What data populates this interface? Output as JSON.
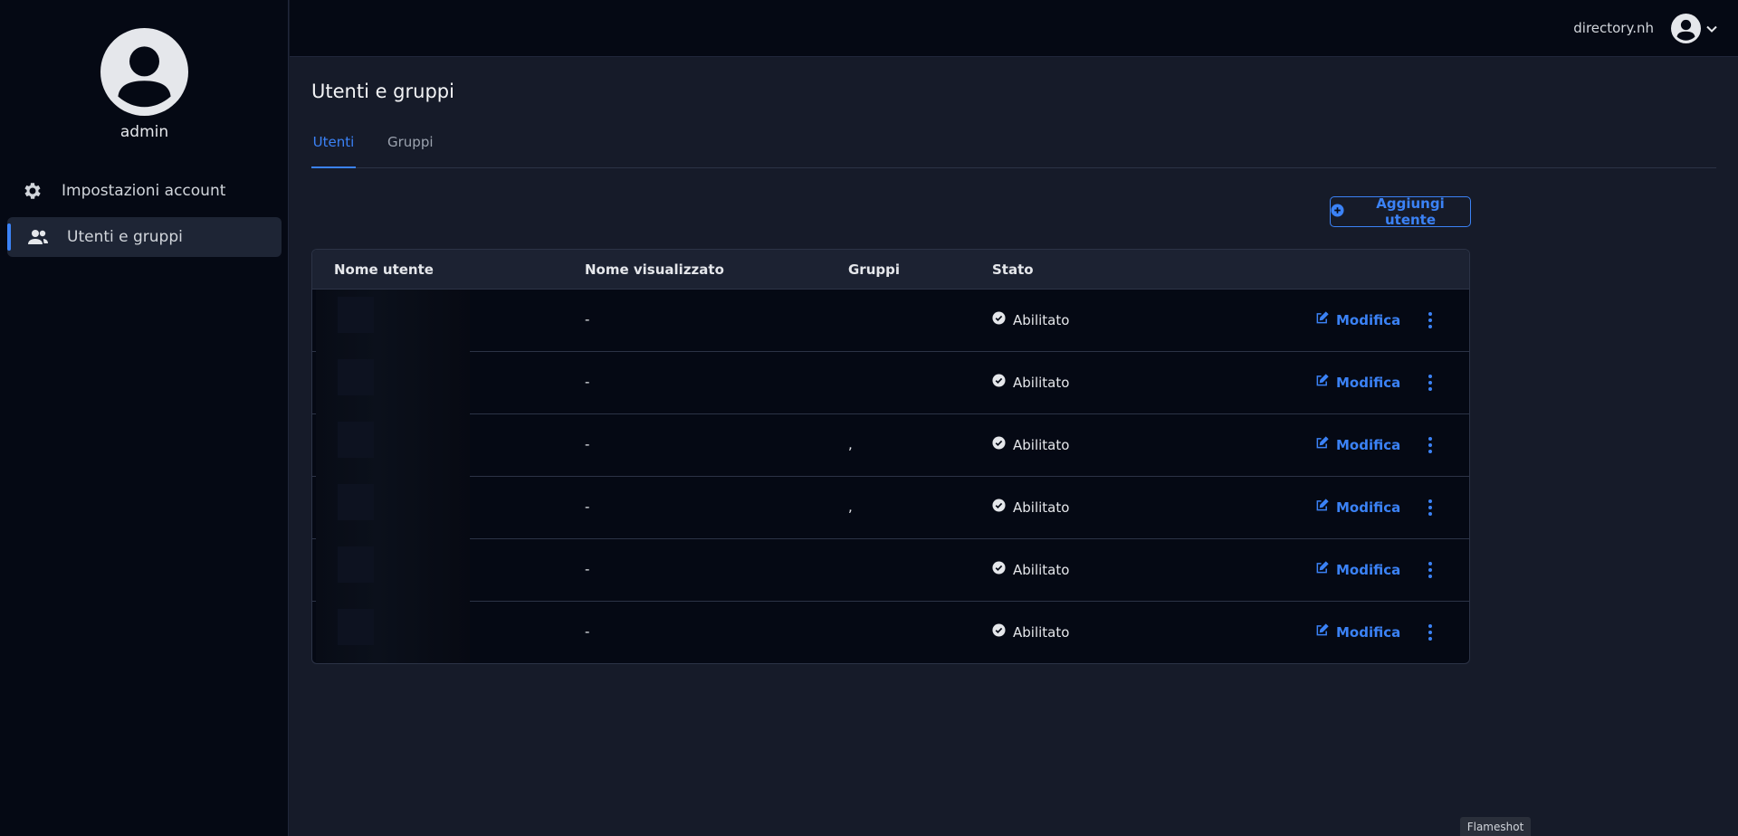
{
  "sidebar": {
    "username": "admin",
    "items": [
      {
        "label": "Impostazioni account",
        "icon": "gear-icon",
        "active": false
      },
      {
        "label": "Utenti e gruppi",
        "icon": "users-icon",
        "active": true
      }
    ]
  },
  "topbar": {
    "domain": "directory.nh"
  },
  "main": {
    "title": "Utenti e gruppi",
    "tabs": [
      {
        "label": "Utenti",
        "active": true
      },
      {
        "label": "Gruppi",
        "active": false
      }
    ],
    "add_button_label": "Aggiungi utente"
  },
  "table": {
    "columns": [
      "Nome utente",
      "Nome visualizzato",
      "Gruppi",
      "Stato"
    ],
    "rows": [
      {
        "display_name": "-",
        "groups": "",
        "status": "Abilitato",
        "edit_label": "Modifica"
      },
      {
        "display_name": "-",
        "groups": "",
        "status": "Abilitato",
        "edit_label": "Modifica"
      },
      {
        "display_name": "-",
        "groups": ",",
        "status": "Abilitato",
        "edit_label": "Modifica"
      },
      {
        "display_name": "-",
        "groups": ",",
        "status": "Abilitato",
        "edit_label": "Modifica"
      },
      {
        "display_name": "-",
        "groups": "",
        "status": "Abilitato",
        "edit_label": "Modifica"
      },
      {
        "display_name": "-",
        "groups": "",
        "status": "Abilitato",
        "edit_label": "Modifica"
      }
    ]
  },
  "overlay": {
    "flameshot_label": "Flameshot"
  },
  "colors": {
    "accent": "#3b82f6",
    "sidebar_bg": "#050914",
    "main_bg": "#161b29"
  }
}
